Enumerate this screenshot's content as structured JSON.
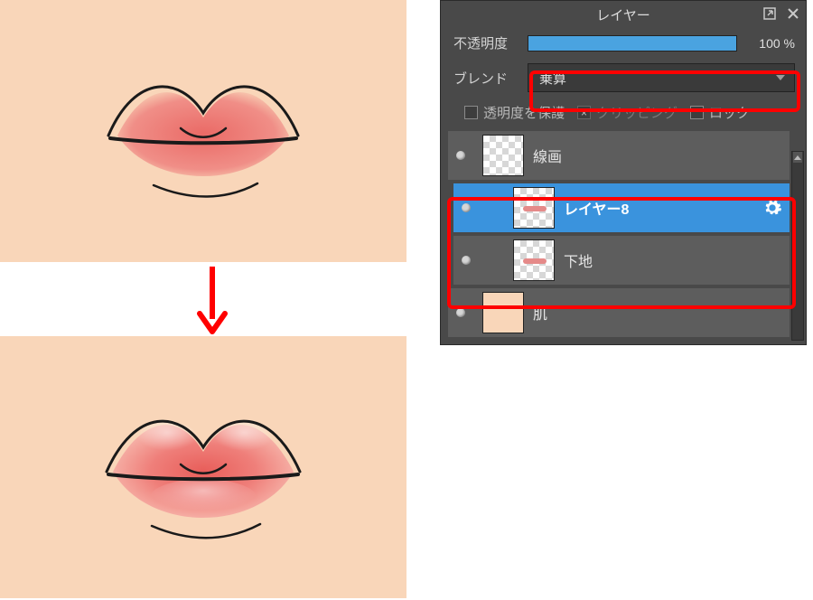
{
  "panel": {
    "title": "レイヤー",
    "opacity_label": "不透明度",
    "opacity_value": "100 %",
    "opacity_percent": 100,
    "blend_label": "ブレンド",
    "blend_value": "乗算",
    "checks": {
      "protect_alpha": "透明度を保護",
      "clipping": "クリッピング",
      "lock": "ロック"
    }
  },
  "layers": [
    {
      "name": "線画",
      "selected": false,
      "indent": 1,
      "thumb": "checker",
      "mini": false
    },
    {
      "name": "レイヤー8",
      "selected": true,
      "indent": 2,
      "thumb": "checker",
      "mini": true,
      "gear": true
    },
    {
      "name": "下地",
      "selected": false,
      "indent": 2,
      "thumb": "checker",
      "mini": true
    },
    {
      "name": "肌",
      "selected": false,
      "indent": 1,
      "thumb": "skin",
      "mini": false
    }
  ],
  "icons": {
    "detach": "detach-icon",
    "close": "close-icon",
    "gear": "gear-icon"
  }
}
